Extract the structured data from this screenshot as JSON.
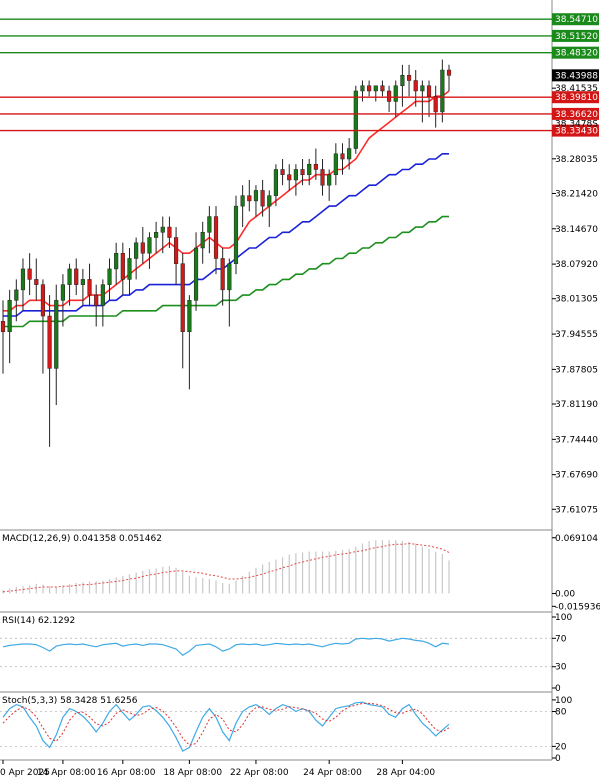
{
  "colors": {
    "bull": "#1a7a1a",
    "bear": "#d11a1a",
    "ma_fast": "#ff2a2a",
    "ma_mid": "#1a22d8",
    "ma_slow": "#1d8f1d",
    "resistance": "#1a8a1a",
    "support": "#d41515",
    "current_tag": "#000000",
    "grid": "#dcdcdc",
    "macd_signal": "#e44b4b",
    "macd_hist": "#c8c8c8",
    "rsi": "#3fa9e6",
    "stoch_main": "#3fa9e6",
    "stoch_signal": "#e03030"
  },
  "chart_data": [
    {
      "type": "candlestick",
      "title": "",
      "ylim": [
        37.575,
        38.58
      ],
      "price_ticks": [
        "38.41535",
        "38.28035",
        "38.21420",
        "38.14670",
        "38.07920",
        "38.01305",
        "37.94555",
        "37.87805",
        "37.81190",
        "37.74440",
        "37.67690",
        "37.61075"
      ],
      "price_tick_values": [
        38.41535,
        38.28035,
        38.2142,
        38.1467,
        38.0792,
        38.01305,
        37.94555,
        37.87805,
        37.8119,
        37.7444,
        37.6769,
        37.61075
      ],
      "extra_label": "38.3478S",
      "extra_label_value": 38.3478,
      "current_price": {
        "label": "38.43988",
        "value": 38.43988
      },
      "resistance_levels": [
        {
          "label": "38.54710",
          "value": 38.5471
        },
        {
          "label": "38.51520",
          "value": 38.5152
        },
        {
          "label": "38.48320",
          "value": 38.4832
        }
      ],
      "support_levels": [
        {
          "label": "38.39810",
          "value": 38.3981
        },
        {
          "label": "38.36620",
          "value": 38.3662
        },
        {
          "label": "38.33430",
          "value": 38.3343
        }
      ],
      "x_labels": [
        "0 Apr 2025",
        "14 Apr 08:00",
        "16 Apr 08:00",
        "18 Apr 08:00",
        "22 Apr 08:00",
        "24 Apr 08:00",
        "28 Apr 04:00"
      ],
      "candles": [
        {
          "o": 37.97,
          "h": 38.01,
          "l": 37.87,
          "c": 37.95
        },
        {
          "o": 37.95,
          "h": 38.03,
          "l": 37.89,
          "c": 38.01
        },
        {
          "o": 38.01,
          "h": 38.05,
          "l": 37.97,
          "c": 38.03
        },
        {
          "o": 38.03,
          "h": 38.09,
          "l": 37.99,
          "c": 38.07
        },
        {
          "o": 38.07,
          "h": 38.1,
          "l": 38.02,
          "c": 38.05
        },
        {
          "o": 38.05,
          "h": 38.09,
          "l": 38.01,
          "c": 38.04
        },
        {
          "o": 38.04,
          "h": 38.05,
          "l": 37.87,
          "c": 37.98
        },
        {
          "o": 37.98,
          "h": 38.02,
          "l": 37.73,
          "c": 37.88
        },
        {
          "o": 37.88,
          "h": 38.04,
          "l": 37.81,
          "c": 38.01
        },
        {
          "o": 38.01,
          "h": 38.06,
          "l": 37.96,
          "c": 38.04
        },
        {
          "o": 38.04,
          "h": 38.08,
          "l": 38.0,
          "c": 38.07
        },
        {
          "o": 38.07,
          "h": 38.09,
          "l": 38.02,
          "c": 38.04
        },
        {
          "o": 38.04,
          "h": 38.07,
          "l": 38.0,
          "c": 38.05
        },
        {
          "o": 38.05,
          "h": 38.08,
          "l": 38.0,
          "c": 38.02
        },
        {
          "o": 38.02,
          "h": 38.04,
          "l": 37.96,
          "c": 38.0
        },
        {
          "o": 38.0,
          "h": 38.05,
          "l": 37.96,
          "c": 38.04
        },
        {
          "o": 38.04,
          "h": 38.09,
          "l": 38.01,
          "c": 38.07
        },
        {
          "o": 38.07,
          "h": 38.12,
          "l": 38.04,
          "c": 38.1
        },
        {
          "o": 38.1,
          "h": 38.12,
          "l": 38.02,
          "c": 38.05
        },
        {
          "o": 38.05,
          "h": 38.11,
          "l": 38.02,
          "c": 38.09
        },
        {
          "o": 38.09,
          "h": 38.13,
          "l": 38.05,
          "c": 38.12
        },
        {
          "o": 38.12,
          "h": 38.15,
          "l": 38.08,
          "c": 38.1
        },
        {
          "o": 38.1,
          "h": 38.14,
          "l": 38.07,
          "c": 38.13
        },
        {
          "o": 38.13,
          "h": 38.16,
          "l": 38.1,
          "c": 38.14
        },
        {
          "o": 38.14,
          "h": 38.17,
          "l": 38.1,
          "c": 38.15
        },
        {
          "o": 38.15,
          "h": 38.17,
          "l": 38.11,
          "c": 38.13
        },
        {
          "o": 38.13,
          "h": 38.15,
          "l": 38.04,
          "c": 38.08
        },
        {
          "o": 38.08,
          "h": 38.1,
          "l": 37.88,
          "c": 37.95
        },
        {
          "o": 37.95,
          "h": 38.02,
          "l": 37.84,
          "c": 38.01
        },
        {
          "o": 38.01,
          "h": 38.14,
          "l": 37.99,
          "c": 38.11
        },
        {
          "o": 38.11,
          "h": 38.16,
          "l": 38.08,
          "c": 38.14
        },
        {
          "o": 38.14,
          "h": 38.19,
          "l": 38.1,
          "c": 38.17
        },
        {
          "o": 38.17,
          "h": 38.19,
          "l": 38.06,
          "c": 38.09
        },
        {
          "o": 38.09,
          "h": 38.11,
          "l": 38.0,
          "c": 38.03
        },
        {
          "o": 38.03,
          "h": 38.09,
          "l": 37.96,
          "c": 38.08
        },
        {
          "o": 38.08,
          "h": 38.21,
          "l": 38.06,
          "c": 38.19
        },
        {
          "o": 38.19,
          "h": 38.23,
          "l": 38.15,
          "c": 38.21
        },
        {
          "o": 38.21,
          "h": 38.24,
          "l": 38.18,
          "c": 38.2
        },
        {
          "o": 38.2,
          "h": 38.23,
          "l": 38.17,
          "c": 38.22
        },
        {
          "o": 38.22,
          "h": 38.24,
          "l": 38.17,
          "c": 38.19
        },
        {
          "o": 38.19,
          "h": 38.22,
          "l": 38.15,
          "c": 38.21
        },
        {
          "o": 38.21,
          "h": 38.27,
          "l": 38.19,
          "c": 38.26
        },
        {
          "o": 38.26,
          "h": 38.28,
          "l": 38.23,
          "c": 38.25
        },
        {
          "o": 38.25,
          "h": 38.27,
          "l": 38.22,
          "c": 38.24
        },
        {
          "o": 38.24,
          "h": 38.27,
          "l": 38.21,
          "c": 38.26
        },
        {
          "o": 38.26,
          "h": 38.28,
          "l": 38.23,
          "c": 38.25
        },
        {
          "o": 38.25,
          "h": 38.28,
          "l": 38.23,
          "c": 38.27
        },
        {
          "o": 38.27,
          "h": 38.3,
          "l": 38.24,
          "c": 38.26
        },
        {
          "o": 38.26,
          "h": 38.28,
          "l": 38.21,
          "c": 38.23
        },
        {
          "o": 38.23,
          "h": 38.26,
          "l": 38.2,
          "c": 38.25
        },
        {
          "o": 38.25,
          "h": 38.31,
          "l": 38.23,
          "c": 38.29
        },
        {
          "o": 38.29,
          "h": 38.31,
          "l": 38.25,
          "c": 38.28
        },
        {
          "o": 38.28,
          "h": 38.32,
          "l": 38.26,
          "c": 38.3
        },
        {
          "o": 38.3,
          "h": 38.42,
          "l": 38.29,
          "c": 38.41
        },
        {
          "o": 38.41,
          "h": 38.43,
          "l": 38.39,
          "c": 38.42
        },
        {
          "o": 38.42,
          "h": 38.43,
          "l": 38.4,
          "c": 38.41
        },
        {
          "o": 38.41,
          "h": 38.42,
          "l": 38.39,
          "c": 38.42
        },
        {
          "o": 38.42,
          "h": 38.43,
          "l": 38.4,
          "c": 38.41
        },
        {
          "o": 38.41,
          "h": 38.42,
          "l": 38.37,
          "c": 38.39
        },
        {
          "o": 38.39,
          "h": 38.43,
          "l": 38.36,
          "c": 38.42
        },
        {
          "o": 38.42,
          "h": 38.46,
          "l": 38.38,
          "c": 38.44
        },
        {
          "o": 38.44,
          "h": 38.46,
          "l": 38.4,
          "c": 38.43
        },
        {
          "o": 38.43,
          "h": 38.45,
          "l": 38.38,
          "c": 38.41
        },
        {
          "o": 38.41,
          "h": 38.43,
          "l": 38.35,
          "c": 38.42
        },
        {
          "o": 38.42,
          "h": 38.43,
          "l": 38.36,
          "c": 38.4
        },
        {
          "o": 38.4,
          "h": 38.42,
          "l": 38.34,
          "c": 38.37
        },
        {
          "o": 38.37,
          "h": 38.47,
          "l": 38.35,
          "c": 38.45
        },
        {
          "o": 38.45,
          "h": 38.46,
          "l": 38.41,
          "c": 38.43988
        }
      ],
      "ma_fast": [
        37.99,
        37.99,
        38.0,
        38.0,
        38.01,
        38.01,
        38.01,
        38.0,
        38.0,
        38.0,
        38.01,
        38.01,
        38.01,
        38.02,
        38.02,
        38.02,
        38.03,
        38.04,
        38.05,
        38.06,
        38.07,
        38.08,
        38.09,
        38.1,
        38.11,
        38.12,
        38.11,
        38.1,
        38.1,
        38.11,
        38.12,
        38.13,
        38.12,
        38.11,
        38.11,
        38.12,
        38.14,
        38.16,
        38.17,
        38.18,
        38.19,
        38.2,
        38.21,
        38.22,
        38.23,
        38.24,
        38.24,
        38.25,
        38.25,
        38.25,
        38.26,
        38.26,
        38.27,
        38.28,
        38.3,
        38.32,
        38.33,
        38.34,
        38.35,
        38.36,
        38.37,
        38.38,
        38.39,
        38.39,
        38.39,
        38.4,
        38.4,
        38.41
      ],
      "ma_mid": [
        37.98,
        37.98,
        37.98,
        37.99,
        37.99,
        37.99,
        37.99,
        37.99,
        37.99,
        37.99,
        37.99,
        37.99,
        38.0,
        38.0,
        38.0,
        38.0,
        38.01,
        38.01,
        38.02,
        38.02,
        38.03,
        38.03,
        38.04,
        38.04,
        38.04,
        38.04,
        38.04,
        38.04,
        38.04,
        38.05,
        38.05,
        38.06,
        38.07,
        38.07,
        38.08,
        38.09,
        38.1,
        38.11,
        38.11,
        38.12,
        38.13,
        38.13,
        38.14,
        38.14,
        38.15,
        38.16,
        38.16,
        38.17,
        38.18,
        38.19,
        38.19,
        38.2,
        38.21,
        38.21,
        38.22,
        38.23,
        38.23,
        38.24,
        38.25,
        38.25,
        38.26,
        38.26,
        38.27,
        38.27,
        38.28,
        38.28,
        38.29,
        38.29
      ],
      "ma_slow": [
        37.96,
        37.96,
        37.96,
        37.96,
        37.97,
        37.97,
        37.97,
        37.97,
        37.97,
        37.97,
        37.98,
        37.98,
        37.98,
        37.98,
        37.98,
        37.98,
        37.98,
        37.98,
        37.99,
        37.99,
        37.99,
        37.99,
        37.99,
        37.99,
        38.0,
        38.0,
        38.0,
        38.0,
        38.0,
        38.0,
        38.0,
        38.0,
        38.0,
        38.01,
        38.01,
        38.01,
        38.02,
        38.02,
        38.03,
        38.03,
        38.04,
        38.04,
        38.05,
        38.05,
        38.06,
        38.06,
        38.07,
        38.07,
        38.08,
        38.08,
        38.09,
        38.09,
        38.1,
        38.1,
        38.11,
        38.11,
        38.12,
        38.12,
        38.13,
        38.13,
        38.14,
        38.14,
        38.15,
        38.15,
        38.16,
        38.16,
        38.17,
        38.17
      ]
    },
    {
      "type": "bar",
      "title": "MACD(12,26,9) 0.041358 0.051462",
      "ylim": [
        -0.018,
        0.075
      ],
      "tick_labels": [
        "0.069104",
        "0.00",
        "-0.015936"
      ],
      "tick_values": [
        0.069104,
        0.0,
        -0.015936
      ],
      "histogram": [
        0.004,
        0.006,
        0.008,
        0.009,
        0.01,
        0.012,
        0.011,
        0.009,
        0.008,
        0.01,
        0.012,
        0.013,
        0.014,
        0.015,
        0.015,
        0.016,
        0.018,
        0.02,
        0.022,
        0.024,
        0.026,
        0.028,
        0.03,
        0.031,
        0.033,
        0.034,
        0.032,
        0.027,
        0.022,
        0.02,
        0.019,
        0.018,
        0.016,
        0.013,
        0.012,
        0.016,
        0.022,
        0.027,
        0.032,
        0.036,
        0.039,
        0.042,
        0.045,
        0.048,
        0.05,
        0.051,
        0.052,
        0.052,
        0.052,
        0.052,
        0.053,
        0.054,
        0.055,
        0.058,
        0.062,
        0.065,
        0.066,
        0.066,
        0.066,
        0.066,
        0.065,
        0.064,
        0.062,
        0.058,
        0.055,
        0.052,
        0.049,
        0.041
      ],
      "signal": [
        0.002,
        0.003,
        0.004,
        0.005,
        0.006,
        0.007,
        0.008,
        0.008,
        0.008,
        0.009,
        0.009,
        0.01,
        0.011,
        0.011,
        0.012,
        0.013,
        0.014,
        0.015,
        0.016,
        0.018,
        0.019,
        0.021,
        0.023,
        0.024,
        0.026,
        0.027,
        0.028,
        0.028,
        0.027,
        0.026,
        0.025,
        0.023,
        0.022,
        0.02,
        0.018,
        0.018,
        0.019,
        0.02,
        0.022,
        0.024,
        0.027,
        0.029,
        0.032,
        0.034,
        0.037,
        0.039,
        0.041,
        0.043,
        0.045,
        0.046,
        0.048,
        0.049,
        0.05,
        0.052,
        0.053,
        0.055,
        0.057,
        0.058,
        0.06,
        0.061,
        0.061,
        0.062,
        0.061,
        0.06,
        0.059,
        0.057,
        0.055,
        0.051
      ]
    },
    {
      "type": "line",
      "title": "RSI(14) 62.1292",
      "ylim": [
        0,
        100
      ],
      "tick_labels": [
        "100",
        "70",
        "30",
        "0"
      ],
      "tick_values": [
        100,
        70,
        30,
        0
      ],
      "values": [
        58,
        60,
        61,
        62,
        62,
        61,
        57,
        52,
        59,
        61,
        62,
        61,
        62,
        60,
        58,
        61,
        62,
        63,
        59,
        61,
        62,
        60,
        62,
        62,
        61,
        58,
        55,
        46,
        52,
        60,
        61,
        62,
        58,
        52,
        55,
        61,
        62,
        61,
        62,
        60,
        61,
        63,
        62,
        61,
        62,
        61,
        62,
        60,
        58,
        61,
        63,
        62,
        63,
        69,
        70,
        69,
        70,
        69,
        66,
        68,
        70,
        69,
        67,
        66,
        63,
        58,
        63,
        62
      ]
    },
    {
      "type": "line",
      "title": "Stoch(5,3,3) 58.3428 51.6256",
      "ylim": [
        0,
        105
      ],
      "tick_labels": [
        "100",
        "80",
        "20",
        "0"
      ],
      "tick_values": [
        100,
        80,
        20,
        0
      ],
      "main": [
        70,
        85,
        92,
        88,
        70,
        55,
        30,
        18,
        40,
        70,
        85,
        80,
        72,
        60,
        45,
        60,
        80,
        92,
        78,
        65,
        75,
        88,
        90,
        82,
        70,
        55,
        35,
        12,
        18,
        45,
        70,
        85,
        70,
        45,
        30,
        60,
        80,
        88,
        92,
        85,
        75,
        85,
        92,
        88,
        80,
        85,
        80,
        65,
        55,
        70,
        85,
        88,
        90,
        95,
        96,
        92,
        90,
        88,
        75,
        70,
        85,
        92,
        75,
        60,
        50,
        38,
        48,
        58
      ],
      "signal": [
        60,
        72,
        82,
        88,
        83,
        71,
        52,
        34,
        29,
        43,
        65,
        78,
        79,
        71,
        59,
        55,
        62,
        77,
        83,
        78,
        73,
        76,
        84,
        87,
        81,
        69,
        53,
        34,
        22,
        25,
        44,
        67,
        75,
        67,
        48,
        45,
        57,
        76,
        87,
        88,
        84,
        82,
        84,
        88,
        87,
        84,
        82,
        77,
        67,
        63,
        70,
        81,
        88,
        91,
        94,
        94,
        93,
        90,
        84,
        78,
        77,
        82,
        84,
        76,
        62,
        49,
        45,
        52
      ]
    }
  ]
}
